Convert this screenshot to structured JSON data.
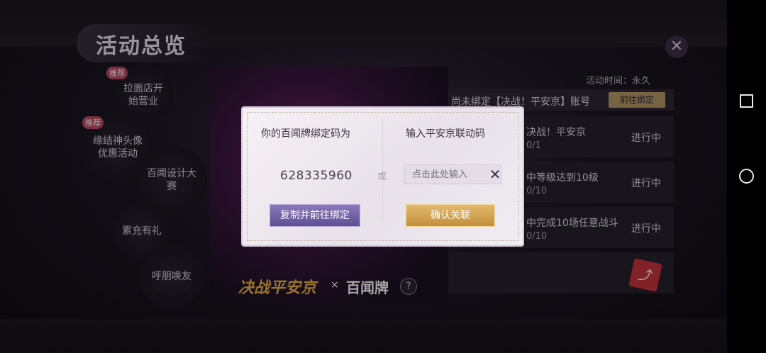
{
  "header": {
    "title": "活动总览",
    "close_icon": "close-icon"
  },
  "activity_time": "活动时间：永久",
  "side_menu": [
    {
      "label": "拉面店开始营业",
      "tag": "推荐"
    },
    {
      "label": "缘结神头像优惠活动",
      "tag": "推荐"
    },
    {
      "label": "百闻设计大赛",
      "tag": ""
    },
    {
      "label": "累充有礼",
      "tag": ""
    },
    {
      "label": "呼朋唤友",
      "tag": ""
    }
  ],
  "banner": {
    "logo_left": "决战平安京",
    "logo_sep": "×",
    "logo_right": "百闻牌",
    "help": "?"
  },
  "bind_bar": {
    "text": "尚未绑定【决战！平安京】账号",
    "button": "前往绑定"
  },
  "tasks": [
    {
      "name": "决战！平安京",
      "progress": "0/1",
      "status": "进行中"
    },
    {
      "name": "中等级达到10级",
      "progress": "0/10",
      "status": "进行中"
    },
    {
      "name": "中完成10场任意战斗",
      "progress": "0/10",
      "status": "进行中"
    }
  ],
  "dialog": {
    "left_title": "你的百闻牌绑定码为",
    "right_title": "输入平安京联动码",
    "code": "628335960",
    "or": "或",
    "input_placeholder": "点击此处输入",
    "copy_button": "复制并前往绑定",
    "confirm_button": "确认关联"
  },
  "colors": {
    "accent_gold": "#c48f3c",
    "accent_purple": "#5e4e94",
    "share_red": "#c8343c"
  }
}
